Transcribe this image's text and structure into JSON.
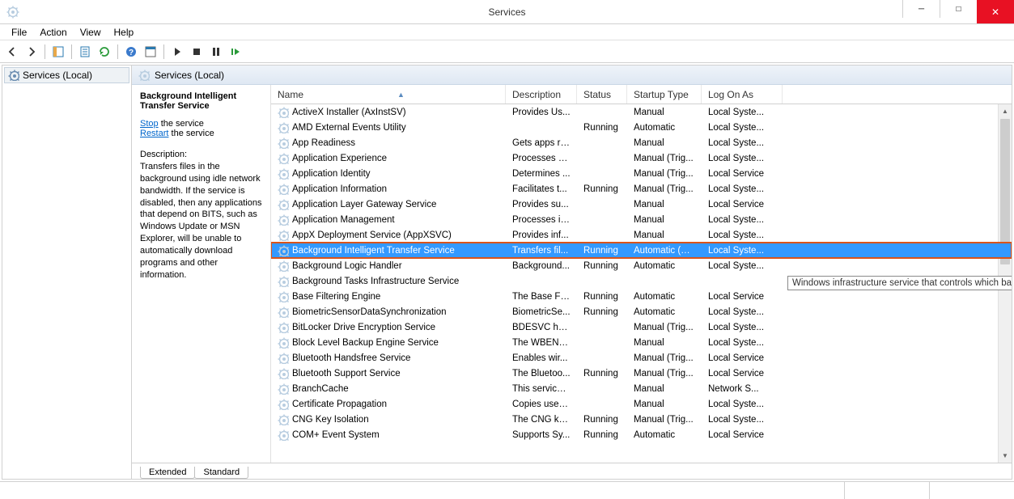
{
  "window": {
    "title": "Services"
  },
  "menu": {
    "file": "File",
    "action": "Action",
    "view": "View",
    "help": "Help"
  },
  "tree": {
    "root": "Services (Local)"
  },
  "right_header": "Services (Local)",
  "detail": {
    "title": "Background Intelligent Transfer Service",
    "stop_word": "Stop",
    "stop_rest": " the service",
    "restart_word": "Restart",
    "restart_rest": " the service",
    "desc_label": "Description:",
    "desc_body": "Transfers files in the background using idle network bandwidth. If the service is disabled, then any applications that depend on BITS, such as Windows Update or MSN Explorer, will be unable to automatically download programs and other information."
  },
  "columns": {
    "name": "Name",
    "description": "Description",
    "status": "Status",
    "startup": "Startup Type",
    "logon": "Log On As"
  },
  "tooltip": "Windows infrastructure service that controls which background tasks can run on the system.",
  "tabs": {
    "extended": "Extended",
    "standard": "Standard"
  },
  "services": [
    {
      "name": "ActiveX Installer (AxInstSV)",
      "desc": "Provides Us...",
      "status": "",
      "startup": "Manual",
      "logon": "Local Syste..."
    },
    {
      "name": "AMD External Events Utility",
      "desc": "",
      "status": "Running",
      "startup": "Automatic",
      "logon": "Local Syste..."
    },
    {
      "name": "App Readiness",
      "desc": "Gets apps re...",
      "status": "",
      "startup": "Manual",
      "logon": "Local Syste..."
    },
    {
      "name": "Application Experience",
      "desc": "Processes a...",
      "status": "",
      "startup": "Manual (Trig...",
      "logon": "Local Syste..."
    },
    {
      "name": "Application Identity",
      "desc": "Determines ...",
      "status": "",
      "startup": "Manual (Trig...",
      "logon": "Local Service"
    },
    {
      "name": "Application Information",
      "desc": "Facilitates t...",
      "status": "Running",
      "startup": "Manual (Trig...",
      "logon": "Local Syste..."
    },
    {
      "name": "Application Layer Gateway Service",
      "desc": "Provides su...",
      "status": "",
      "startup": "Manual",
      "logon": "Local Service"
    },
    {
      "name": "Application Management",
      "desc": "Processes in...",
      "status": "",
      "startup": "Manual",
      "logon": "Local Syste..."
    },
    {
      "name": "AppX Deployment Service (AppXSVC)",
      "desc": "Provides inf...",
      "status": "",
      "startup": "Manual",
      "logon": "Local Syste..."
    },
    {
      "name": "Background Intelligent Transfer Service",
      "desc": "Transfers fil...",
      "status": "Running",
      "startup": "Automatic (D...",
      "logon": "Local Syste...",
      "selected": true,
      "highlighted": true
    },
    {
      "name": "Background Logic Handler",
      "desc": "Background...",
      "status": "Running",
      "startup": "Automatic",
      "logon": "Local Syste..."
    },
    {
      "name": "Background Tasks Infrastructure Service",
      "desc": "",
      "status": "",
      "startup": "",
      "logon": "",
      "tooltip": true
    },
    {
      "name": "Base Filtering Engine",
      "desc": "The Base Fil...",
      "status": "Running",
      "startup": "Automatic",
      "logon": "Local Service"
    },
    {
      "name": "BiometricSensorDataSynchronization",
      "desc": "BiometricSe...",
      "status": "Running",
      "startup": "Automatic",
      "logon": "Local Syste..."
    },
    {
      "name": "BitLocker Drive Encryption Service",
      "desc": "BDESVC hos...",
      "status": "",
      "startup": "Manual (Trig...",
      "logon": "Local Syste..."
    },
    {
      "name": "Block Level Backup Engine Service",
      "desc": "The WBENG...",
      "status": "",
      "startup": "Manual",
      "logon": "Local Syste..."
    },
    {
      "name": "Bluetooth Handsfree Service",
      "desc": "Enables wir...",
      "status": "",
      "startup": "Manual (Trig...",
      "logon": "Local Service"
    },
    {
      "name": "Bluetooth Support Service",
      "desc": "The Bluetoo...",
      "status": "Running",
      "startup": "Manual (Trig...",
      "logon": "Local Service"
    },
    {
      "name": "BranchCache",
      "desc": "This service ...",
      "status": "",
      "startup": "Manual",
      "logon": "Network S..."
    },
    {
      "name": "Certificate Propagation",
      "desc": "Copies user ...",
      "status": "",
      "startup": "Manual",
      "logon": "Local Syste..."
    },
    {
      "name": "CNG Key Isolation",
      "desc": "The CNG ke...",
      "status": "Running",
      "startup": "Manual (Trig...",
      "logon": "Local Syste..."
    },
    {
      "name": "COM+ Event System",
      "desc": "Supports Sy...",
      "status": "Running",
      "startup": "Automatic",
      "logon": "Local Service"
    }
  ]
}
